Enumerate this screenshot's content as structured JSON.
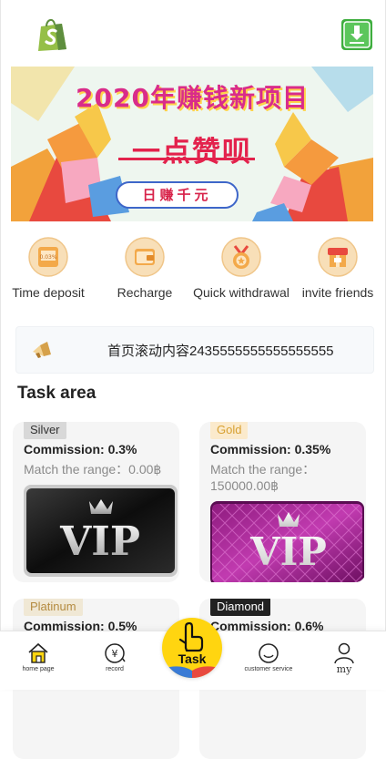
{
  "header": {
    "logo_icon": "shopify-bag-icon",
    "download_icon": "download-icon"
  },
  "banner": {
    "title": "2020年赚钱新项目",
    "subtitle": "一点赞呗",
    "pill": "日赚千元"
  },
  "menu": {
    "items": [
      {
        "label": "Time deposit",
        "icon": "deposit-box-icon"
      },
      {
        "label": "Recharge",
        "icon": "wallet-icon"
      },
      {
        "label": "Quick withdrawal",
        "icon": "medal-icon"
      },
      {
        "label": "invite friends",
        "icon": "gift-box-icon"
      }
    ]
  },
  "notice": {
    "icon": "megaphone-icon",
    "text": "首页滚动内容2435555555555555555"
  },
  "task_area": {
    "title": "Task area",
    "cards": [
      {
        "tag": "Silver",
        "commission": "Commission:  0.3%",
        "range": "Match the range：0.00฿",
        "image": "VIP"
      },
      {
        "tag": "Gold",
        "commission": "Commission:  0.35%",
        "range": "Match the range：150000.00฿",
        "image": "VIP"
      },
      {
        "tag": "Platinum",
        "commission": "Commission:  0.5%",
        "range": ""
      },
      {
        "tag": "Diamond",
        "commission": "Commission:  0.6%",
        "range": ""
      }
    ]
  },
  "tabbar": {
    "home": "home page",
    "record": "record",
    "task": "Task",
    "service": "customer service",
    "my": "my",
    "accent": "#ffd510"
  }
}
